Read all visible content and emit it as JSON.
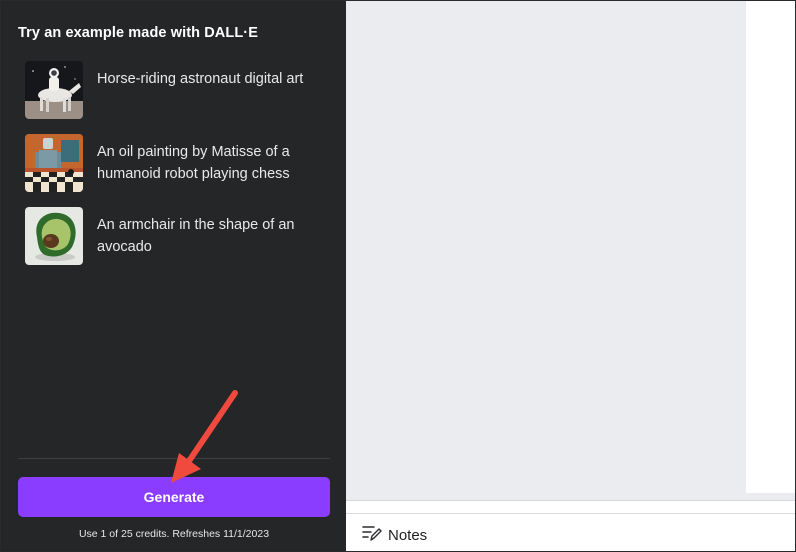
{
  "panel": {
    "title": "Try an example made with DALL·E",
    "examples": [
      {
        "label": "Horse-riding astronaut digital art"
      },
      {
        "label": "An oil painting by Matisse of a humanoid robot playing chess"
      },
      {
        "label": "An armchair in the shape of an avocado"
      }
    ],
    "generate_label": "Generate",
    "credits_text": "Use 1 of 25 credits. Refreshes 11/1/2023"
  },
  "footer": {
    "notes_label": "Notes"
  },
  "colors": {
    "panel_bg": "#252627",
    "accent": "#8b3dff",
    "annotation_arrow": "#f04a3e"
  },
  "icons": {
    "collapse": "chevron-left-icon",
    "notes": "notes-pencil-icon"
  }
}
